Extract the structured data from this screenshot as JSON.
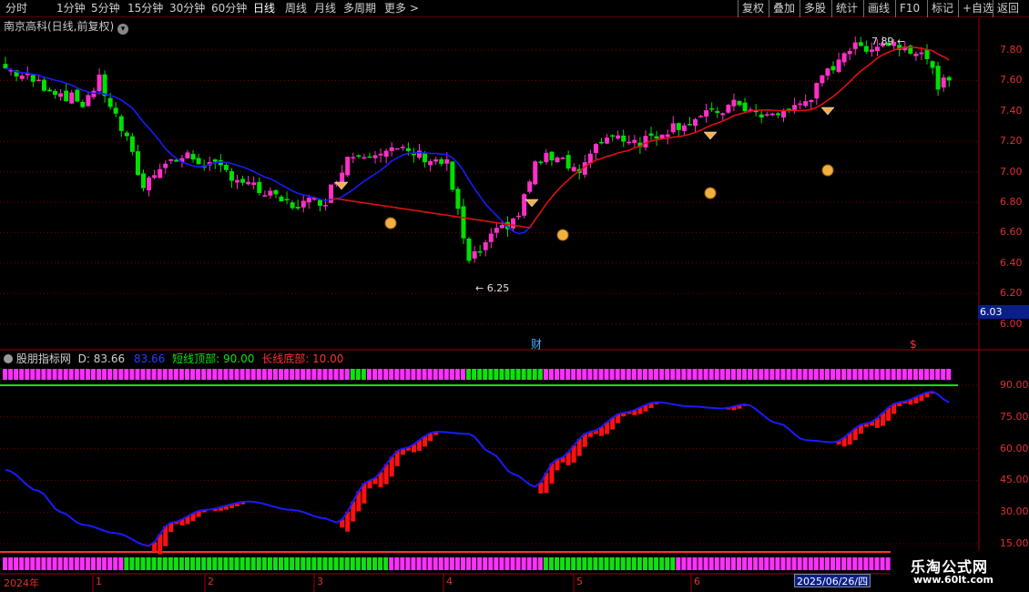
{
  "toolbar": {
    "periods": [
      "分时",
      "1分钟",
      "5分钟",
      "15分钟",
      "30分钟",
      "60分钟",
      "日线",
      "周线",
      "月线",
      "多周期",
      "更多 >"
    ],
    "active": "日线",
    "right_buttons": [
      "复权",
      "叠加",
      "多股",
      "统计",
      "画线",
      "F10",
      "标记",
      "+自选",
      "返回"
    ]
  },
  "main_panel": {
    "title": "南京高科(日线,前复权)",
    "high_label": "7.89",
    "low_label": "6.25",
    "current_price": "6.03",
    "y_ticks": [
      "7.80",
      "7.60",
      "7.40",
      "7.20",
      "7.00",
      "6.80",
      "6.60",
      "6.40",
      "6.20",
      "6.00"
    ],
    "marker_cai": "财",
    "marker_s": "$"
  },
  "indicator": {
    "name": "股朋指标网",
    "d_label": "D: 83.66",
    "d2_label": "83.66",
    "short_top": "短线顶部: 90.00",
    "long_bottom": "长线底部: 10.00",
    "y_ticks": [
      "90.00",
      "75.00",
      "60.00",
      "45.00",
      "30.00",
      "15.00"
    ]
  },
  "x_axis": {
    "labels": [
      "2024年",
      "1",
      "2",
      "3",
      "4",
      "5",
      "6"
    ],
    "cursor_date": "2025/06/26/四"
  },
  "watermark": {
    "title": "乐淘公式网",
    "url": "www.60lt.com"
  },
  "colors": {
    "up": "#ff30c8",
    "down": "#00e000",
    "ma_blue": "#1a1aff",
    "ma_red": "#e01010",
    "grid": "#7a0000",
    "axis": "#a00000"
  }
}
